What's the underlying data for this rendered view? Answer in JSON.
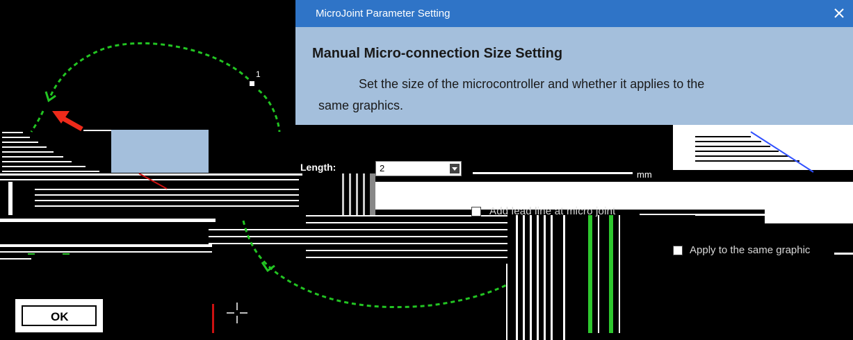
{
  "tooltip": {
    "title": "MicroJoint Parameter Setting",
    "close_icon": "close-icon",
    "heading": "Manual Micro-connection Size Setting",
    "body_line1": "Set the size of the microcontroller and whether it applies to the",
    "body_line2": "same graphics."
  },
  "dialog": {
    "length_label": "Length:",
    "length_value": "2",
    "unit_label": "mm",
    "lead_checkbox_label": "Add lead line at micro joint",
    "lead_checked": false,
    "apply_checkbox_label": "Apply to the same graphic",
    "apply_checked": false,
    "ok_label": "OK"
  },
  "canvas": {
    "point_label": "1",
    "path_color": "#22c422",
    "arrow_color": "#ee2a1a",
    "panel_color": "#a4bfdc",
    "titlebar_color": "#2f74c7"
  }
}
